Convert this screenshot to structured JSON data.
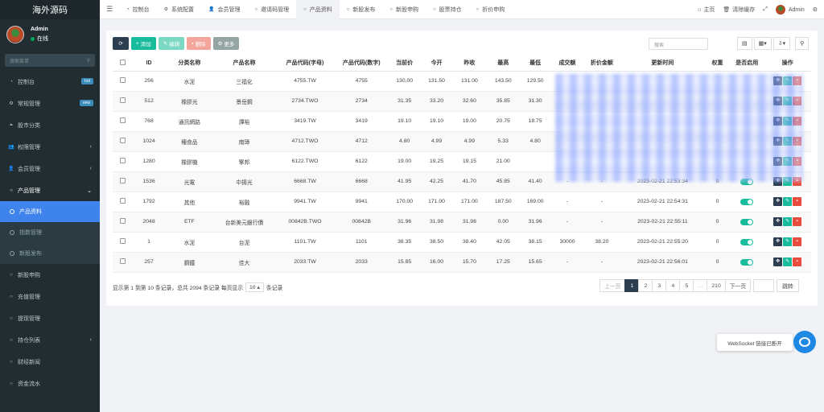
{
  "brand": "海外源码",
  "user": {
    "name": "Admin",
    "status": "在线"
  },
  "sidebar": {
    "search_placeholder": "搜索菜单",
    "items": [
      {
        "label": "控制台",
        "icon": "dashboard-icon",
        "badge": "hot",
        "badge_color": "#3c8dbc"
      },
      {
        "label": "常规管理",
        "icon": "cogs-icon",
        "badge": "new",
        "badge_color": "#3c8dbc"
      },
      {
        "label": "股市分类",
        "icon": "leaf-icon"
      },
      {
        "label": "权限管理",
        "icon": "group-icon",
        "chevron": "‹"
      },
      {
        "label": "会员管理",
        "icon": "user-icon",
        "chevron": "‹"
      },
      {
        "label": "产品管理",
        "icon": "circle-icon",
        "chevron": "⌄"
      }
    ],
    "subitems": [
      {
        "label": "产品资料",
        "active": true
      },
      {
        "label": "指数管理"
      },
      {
        "label": "新股发布"
      }
    ],
    "items_after": [
      {
        "label": "新股申购",
        "icon": "circle-icon"
      },
      {
        "label": "充值管理",
        "icon": "circle-icon"
      },
      {
        "label": "提现管理",
        "icon": "circle-icon"
      },
      {
        "label": "持仓列表",
        "icon": "circle-icon",
        "chevron": "‹"
      },
      {
        "label": "财经新闻",
        "icon": "circle-icon"
      },
      {
        "label": "资金流水",
        "icon": "circle-icon"
      }
    ]
  },
  "topnav": {
    "tabs": [
      {
        "label": "控制台",
        "icon": "dashboard-icon"
      },
      {
        "label": "系统配置",
        "icon": "gear-icon"
      },
      {
        "label": "会员管理",
        "icon": "user-icon"
      },
      {
        "label": "邀请码管理",
        "icon": "circle-icon"
      },
      {
        "label": "产品资料",
        "icon": "circle-icon",
        "active": true
      },
      {
        "label": "新股发布",
        "icon": "circle-icon"
      },
      {
        "label": "新股申购",
        "icon": "circle-icon"
      },
      {
        "label": "股票持仓",
        "icon": "circle-icon"
      },
      {
        "label": "折价申购",
        "icon": "circle-icon"
      }
    ],
    "home": "主页",
    "clear_cache": "清除缓存",
    "admin": "Admin"
  },
  "toolbar": {
    "add": "添加",
    "edit": "编辑",
    "delete": "删除",
    "more": "更多",
    "search_placeholder": "搜索"
  },
  "table": {
    "columns": [
      "ID",
      "分类名称",
      "产品名称",
      "产品代码(字母)",
      "产品代码(数字)",
      "当前价",
      "今开",
      "昨收",
      "最高",
      "最低",
      "成交额",
      "折价金额",
      "更新时间",
      "权重",
      "是否启用",
      "操作"
    ],
    "rows": [
      [
        "256",
        "水泥",
        "三福化",
        "4755.TW",
        "4755",
        "130.00",
        "131.50",
        "131.00",
        "143.50",
        "129.50",
        "",
        "",
        "",
        "",
        ""
      ],
      [
        "512",
        "橡膠光",
        "景岳鋼",
        "2734.TWO",
        "2734",
        "31.35",
        "33.20",
        "32.60",
        "35.85",
        "31.30",
        "",
        "",
        "",
        "",
        ""
      ],
      [
        "768",
        "通訊網路",
        "譚裕",
        "3419.TW",
        "3419",
        "19.10",
        "19.10",
        "19.00",
        "20.75",
        "18.75",
        "",
        "",
        "",
        "",
        ""
      ],
      [
        "1024",
        "種食品",
        "南璋",
        "4712.TWO",
        "4712",
        "4.80",
        "4.99",
        "4.99",
        "5.33",
        "4.80",
        "",
        "",
        "",
        "",
        ""
      ],
      [
        "1280",
        "橡膠機",
        "擎邦",
        "6122.TWO",
        "6122",
        "19.00",
        "19.25",
        "19.15",
        "21.00",
        "",
        "",
        "",
        "",
        "",
        ""
      ],
      [
        "1536",
        "光電",
        "中揚光",
        "6668.TW",
        "6668",
        "41.95",
        "42.25",
        "41.70",
        "45.85",
        "41.40",
        "-",
        "-",
        "2023-02-21 22:53:34",
        "0",
        "on"
      ],
      [
        "1792",
        "其他",
        "裕融",
        "9941.TW",
        "9941",
        "170.00",
        "171.00",
        "171.00",
        "187.50",
        "169.00",
        "-",
        "-",
        "2023-02-21 22:54:31",
        "0",
        "on"
      ],
      [
        "2048",
        "ETF",
        "台新美元銀行債",
        "00842B.TWO",
        "00842B",
        "31.96",
        "31.98",
        "31.98",
        "0.00",
        "31.96",
        "-",
        "-",
        "2023-02-21 22:55:11",
        "0",
        "on"
      ],
      [
        "1",
        "水泥",
        "台泥",
        "1101.TW",
        "1101",
        "38.35",
        "38.50",
        "38.40",
        "42.05",
        "38.15",
        "30000",
        "38.20",
        "2023-02-21 22:55:20",
        "0",
        "on"
      ],
      [
        "257",
        "鋼鐵",
        "佳大",
        "2033.TW",
        "2033",
        "15.85",
        "16.00",
        "15.70",
        "17.25",
        "15.65",
        "-",
        "-",
        "2023-02-21 22:56:01",
        "0",
        "on"
      ]
    ]
  },
  "pagination": {
    "info_prefix": "显示第 1 到第 10 条记录，总共 2094 条记录 每页显示",
    "page_size": "10",
    "info_suffix": "条记录",
    "prev": "上一页",
    "pages": [
      "1",
      "2",
      "3",
      "4",
      "5",
      "...",
      "210"
    ],
    "next": "下一页",
    "jump": "跳转"
  },
  "toast": "WebSocket 链接已断开",
  "colors": {
    "sidebar": "#222d32",
    "active": "#3f83ec",
    "success": "#18bc9c",
    "danger": "#e74c3c",
    "dark": "#2c3e50"
  }
}
